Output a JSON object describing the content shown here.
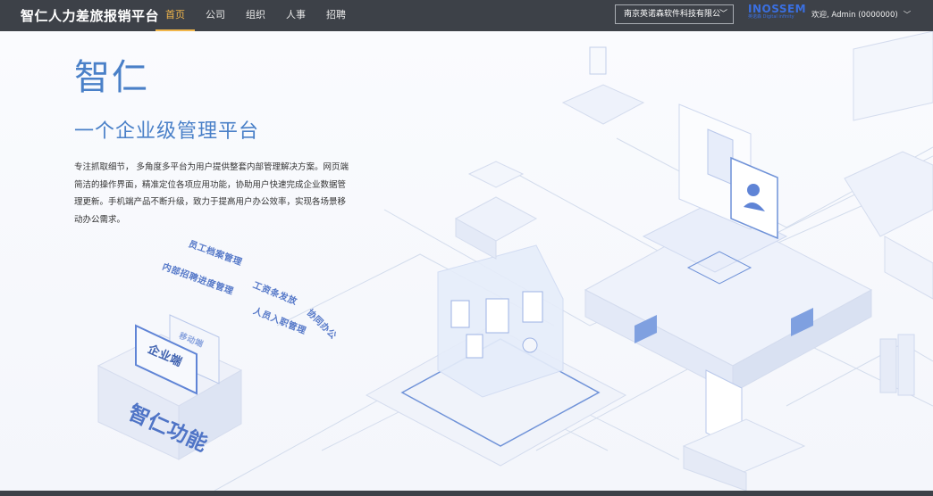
{
  "app": {
    "title": "智仁人力差旅报销平台"
  },
  "nav": {
    "items": [
      {
        "label": "首页",
        "active": true
      },
      {
        "label": "公司",
        "active": false
      },
      {
        "label": "组织",
        "active": false
      },
      {
        "label": "人事",
        "active": false
      },
      {
        "label": "招聘",
        "active": false
      }
    ]
  },
  "company_select": {
    "value": "南京英诺森软件科技有限公"
  },
  "logo": {
    "main": "INOSSEM",
    "sub": "英诺森 Digital infinity"
  },
  "user": {
    "greeting": "欢迎, Admin (0000000)"
  },
  "hero": {
    "title": "智仁",
    "subtitle": "一个企业级管理平台",
    "description": "专注抓取细节， 多角度多平台为用户提供整套内部管理解决方案。网页端简洁的操作界面，精准定位各项应用功能，协助用户快速完成企业数据管理更新。手机端产品不断升级，致力于提高用户办公效率，实现各场景移动办公需求。"
  },
  "illustration": {
    "features": [
      {
        "label": "员工档案管理"
      },
      {
        "label": "内部招聘进度管理"
      },
      {
        "label": "工资条发放"
      },
      {
        "label": "人员入职管理"
      },
      {
        "label": "协同办公"
      }
    ],
    "mobile_card": "移动端",
    "enterprise_card": "企业端",
    "cube_text": "智仁功能"
  },
  "colors": {
    "topbar": "#3d4148",
    "accent": "#f1b64b",
    "brand_blue": "#4a80c8"
  }
}
